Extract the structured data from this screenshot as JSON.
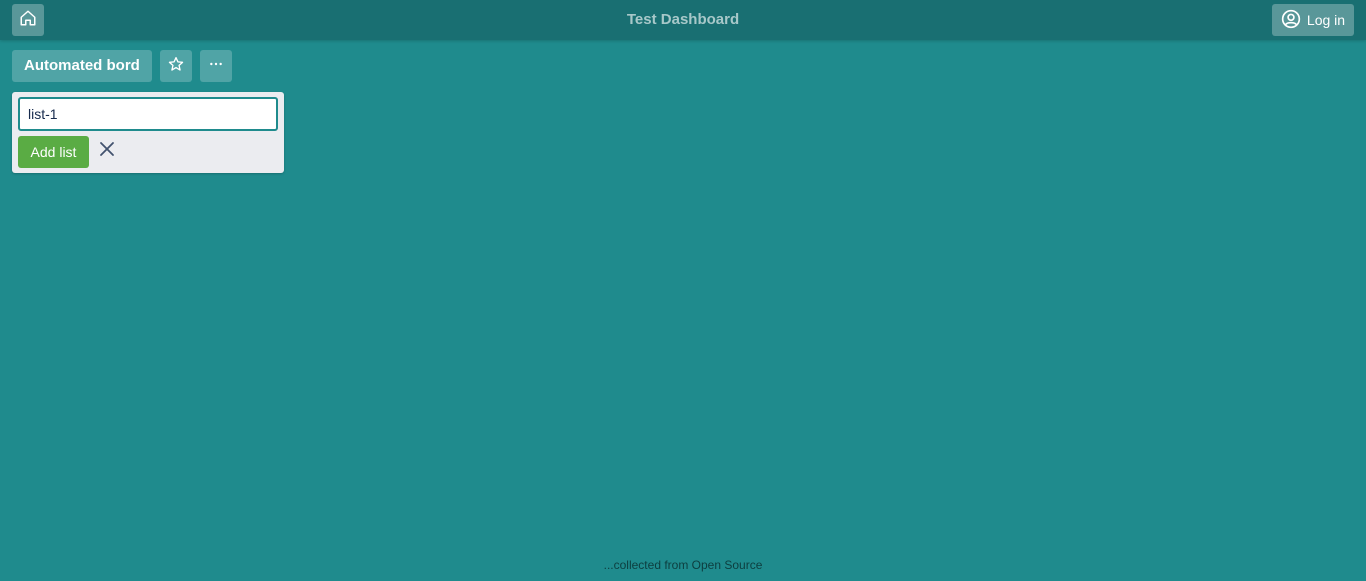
{
  "header": {
    "title": "Test Dashboard",
    "home_icon": "home-icon",
    "login_label": "Log in",
    "login_icon": "user-circle-icon"
  },
  "board": {
    "name": "Automated bord",
    "star_icon": "star-icon",
    "menu_icon": "more-horizontal-icon"
  },
  "add_list": {
    "input_value": "list-1",
    "button_label": "Add list",
    "cancel_icon": "close-icon"
  },
  "footer": {
    "text": "...collected from Open Source"
  },
  "colors": {
    "background": "#1f8b8d",
    "topbar": "#196f72",
    "add_button": "#5aac44"
  }
}
